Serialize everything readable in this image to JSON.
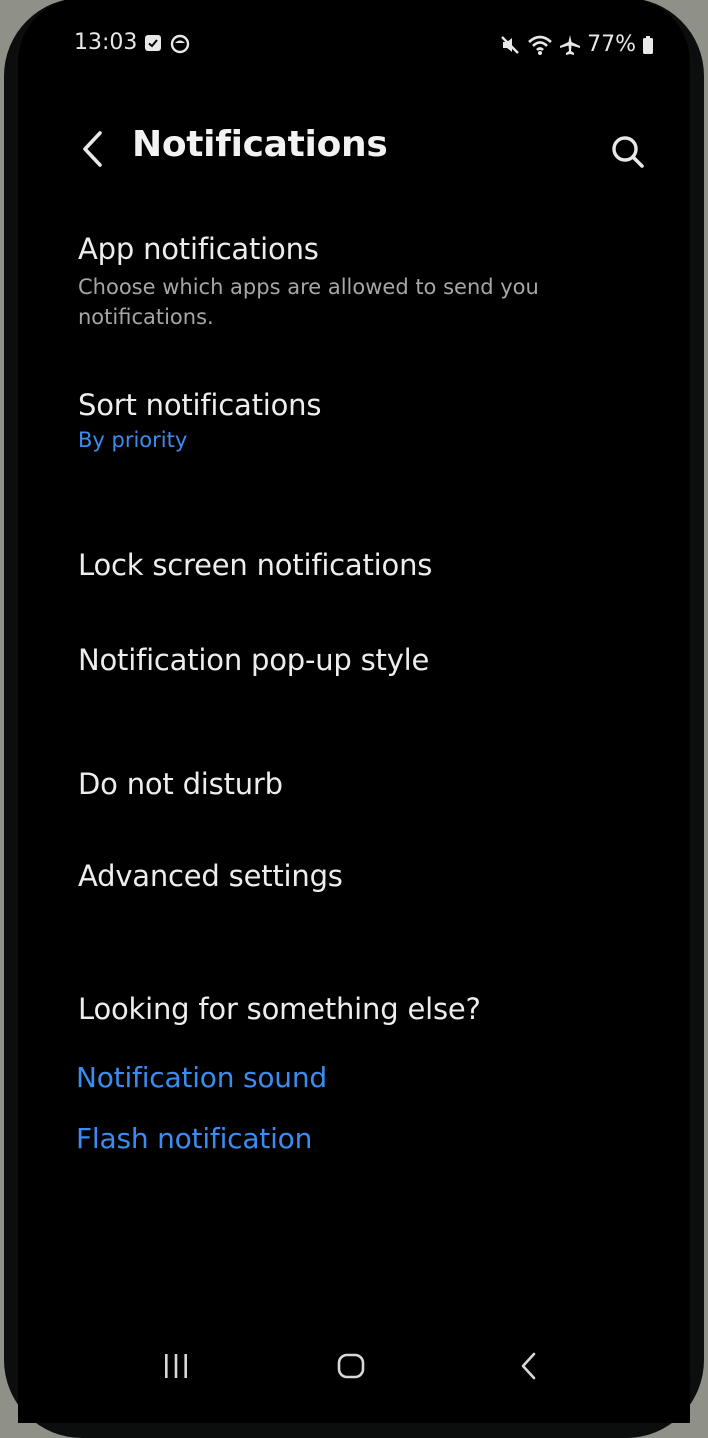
{
  "status_bar": {
    "time": "13:03",
    "battery": "77%",
    "left_icons": [
      "checkbox-notification-icon",
      "circle-notification-icon"
    ],
    "right_icons": [
      "mute-icon",
      "wifi-icon",
      "airplane-mode-icon",
      "battery-icon"
    ]
  },
  "header": {
    "title": "Notifications",
    "back_icon": "chevron-left-icon",
    "search_icon": "search-icon"
  },
  "items": [
    {
      "title": "App notifications",
      "subtitle": "Choose which apps are allowed to send you notifications."
    },
    {
      "title": "Sort notifications",
      "value": "By priority"
    },
    {
      "title": "Lock screen notifications"
    },
    {
      "title": "Notification pop-up style"
    },
    {
      "title": "Do not disturb"
    },
    {
      "title": "Advanced settings"
    }
  ],
  "suggestions": {
    "heading": "Looking for something else?",
    "links": [
      "Notification sound",
      "Flash notification"
    ]
  },
  "nav_bar": {
    "icons": [
      "recents-icon",
      "home-icon",
      "back-icon"
    ]
  },
  "colors": {
    "background": "#000000",
    "text": "#ededed",
    "secondary_text": "#a6a6a6",
    "accent": "#3b8cf0"
  }
}
